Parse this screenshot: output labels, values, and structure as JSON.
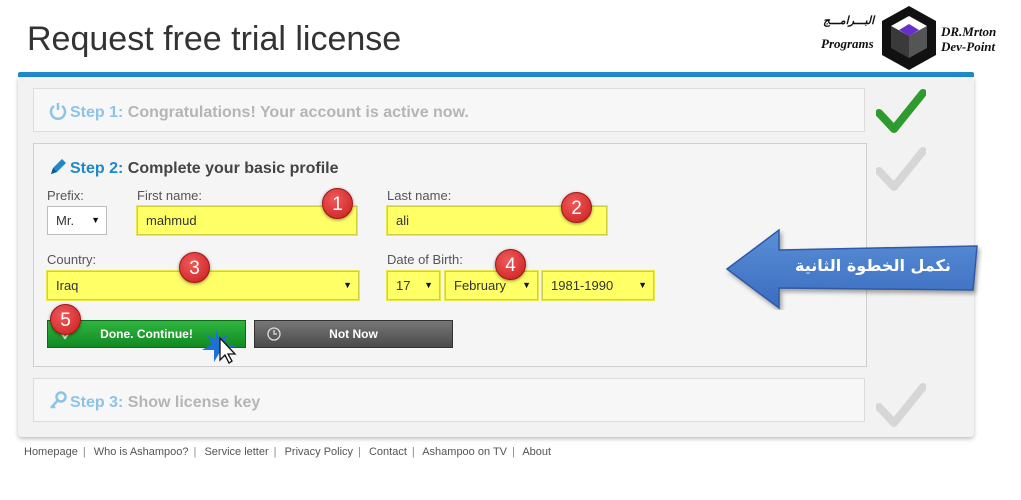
{
  "header": {
    "title": "Request free trial license"
  },
  "logo": {
    "arabic": "البـــرامـــج",
    "programs": "Programs",
    "author": "DR.Mrton",
    "site": "Dev-Point"
  },
  "step1": {
    "num": "Step 1:",
    "text": " Congratulations! Your account is active now."
  },
  "step2": {
    "num": "Step 2:",
    "text": " Complete your basic profile",
    "prefix_label": "Prefix:",
    "prefix_value": "Mr.",
    "first_label": "First name:",
    "first_value": "mahmud",
    "last_label": "Last name:",
    "last_value": "ali",
    "country_label": "Country:",
    "country_value": "Iraq",
    "dob_label": "Date of Birth:",
    "dob_day": "17",
    "dob_month": "February",
    "dob_year": "1981-1990",
    "done_label": "Done. Continue!",
    "notnow_label": "Not Now"
  },
  "step3": {
    "num": "Step 3:",
    "text": " Show license key"
  },
  "badges": [
    "1",
    "2",
    "3",
    "4",
    "5"
  ],
  "callout": {
    "text": "نكمل الخطوة الثانية"
  },
  "footer": {
    "links": [
      "Homepage",
      "Who is Ashampoo?",
      "Service letter",
      "Privacy Policy",
      "Contact",
      "Ashampoo on TV",
      "About"
    ]
  },
  "colors": {
    "accent": "#1e88c8",
    "highlight": "#ffff66",
    "done": "#1a9b2c",
    "badge": "#d62b2b",
    "check_active": "#2e9b2e",
    "check_inactive": "#d6d6d6"
  }
}
